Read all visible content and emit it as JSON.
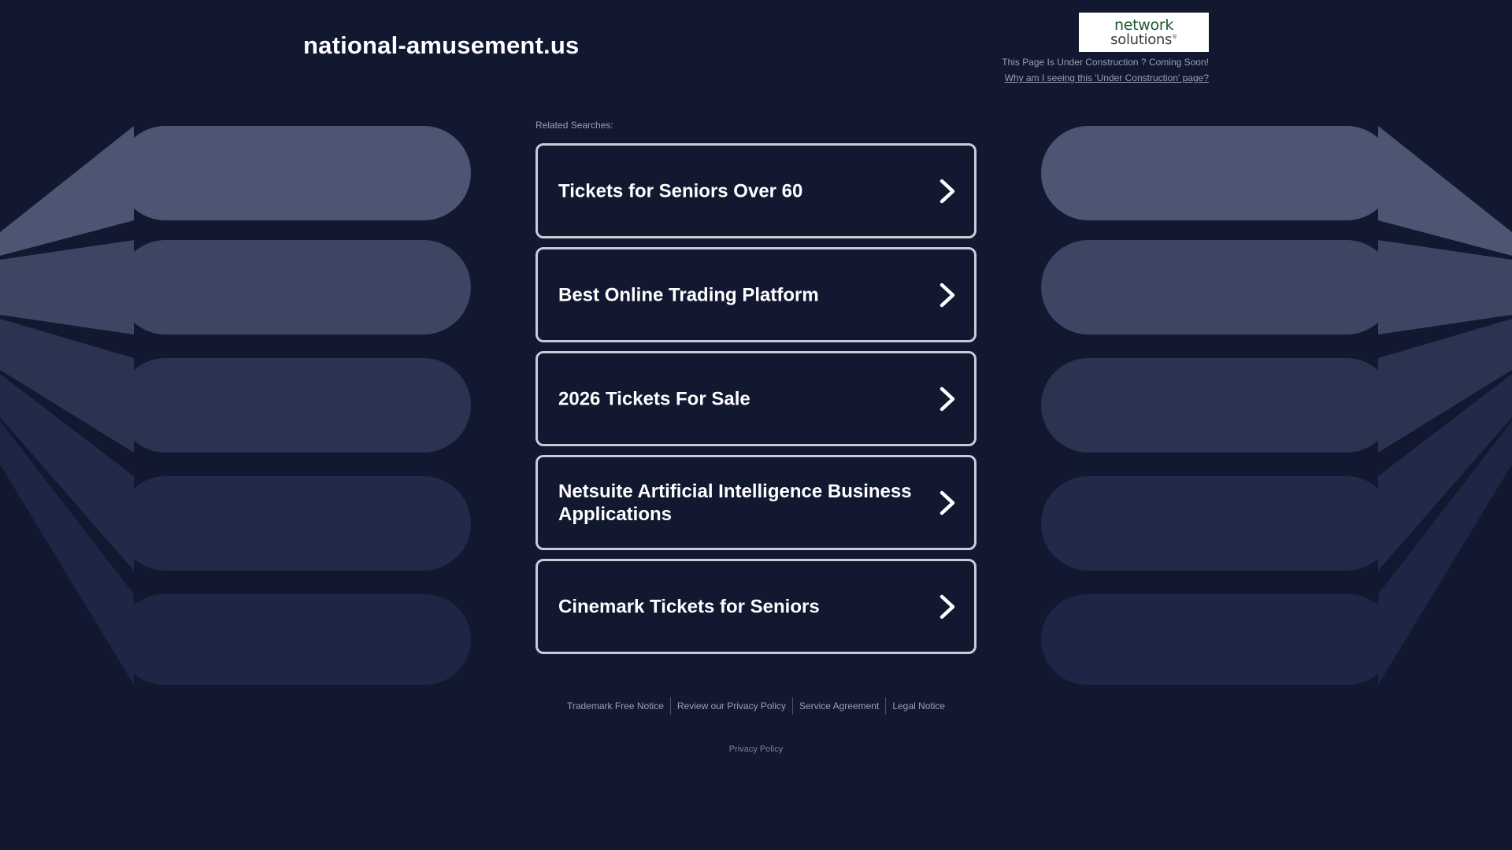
{
  "header": {
    "domain": "national-amusement.us",
    "logo_line1": "network",
    "logo_line2": "solutions",
    "notice": "This Page Is Under Construction ? Coming Soon!",
    "why_link": "Why am I seeing this 'Under Construction' page?"
  },
  "related": {
    "label": "Related Searches:",
    "items": [
      "Tickets for Seniors Over 60",
      "Best Online Trading Platform",
      "2026 Tickets For Sale",
      "Netsuite Artificial Intelligence Business Applications",
      "Cinemark Tickets for Seniors"
    ]
  },
  "footer": {
    "links": [
      "Trademark Free Notice",
      "Review our Privacy Policy",
      "Service Agreement",
      "Legal Notice"
    ],
    "privacy": "Privacy Policy"
  },
  "colors": {
    "background": "#111830",
    "card_border": "#c9ccd6",
    "text_muted": "#9aa0b4"
  }
}
